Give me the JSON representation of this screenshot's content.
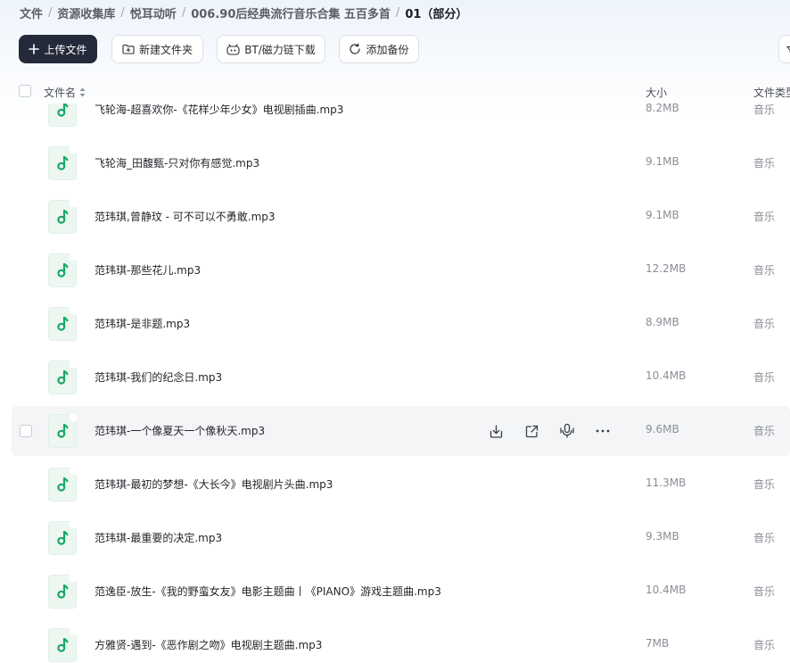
{
  "breadcrumb": {
    "items": [
      "文件",
      "资源收集库",
      "悦耳动听",
      "006.90后经典流行音乐合集 五百多首"
    ],
    "current": "01（部分）",
    "separator": "/"
  },
  "toolbar": {
    "upload_label": "上传文件",
    "new_folder_label": "新建文件夹",
    "bt_label": "BT/磁力链下载",
    "backup_label": "添加备份"
  },
  "table": {
    "headers": {
      "name": "文件名",
      "size": "大小",
      "type": "文件类型"
    },
    "rows": [
      {
        "name": "飞轮海-超喜欢你-《花样少年少女》电视剧插曲.mp3",
        "size": "8.2MB",
        "type": "音乐"
      },
      {
        "name": "飞轮海_田馥甄-只对你有感觉.mp3",
        "size": "9.1MB",
        "type": "音乐"
      },
      {
        "name": "范玮琪,曾静玟 - 可不可以不勇敢.mp3",
        "size": "9.1MB",
        "type": "音乐"
      },
      {
        "name": "范玮琪-那些花儿.mp3",
        "size": "12.2MB",
        "type": "音乐"
      },
      {
        "name": "范玮琪-是非题.mp3",
        "size": "8.9MB",
        "type": "音乐"
      },
      {
        "name": "范玮琪-我们的纪念日.mp3",
        "size": "10.4MB",
        "type": "音乐"
      },
      {
        "name": "范玮琪-一个像夏天一个像秋天.mp3",
        "size": "9.6MB",
        "type": "音乐",
        "hovered": true
      },
      {
        "name": "范玮琪-最初的梦想-《大长今》电视剧片头曲.mp3",
        "size": "11.3MB",
        "type": "音乐"
      },
      {
        "name": "范玮琪-最重要的决定.mp3",
        "size": "9.3MB",
        "type": "音乐"
      },
      {
        "name": "范逸臣-放生-《我的野蛮女友》电影主题曲丨《PIANO》游戏主题曲.mp3",
        "size": "10.4MB",
        "type": "音乐"
      },
      {
        "name": "方雅贤-遇到-《恶作剧之吻》电视剧主题曲.mp3",
        "size": "7MB",
        "type": "音乐"
      }
    ]
  },
  "icons": {
    "file": "music-note-icon",
    "row_actions": [
      "download-icon",
      "share-icon",
      "voice-icon",
      "more-icon"
    ]
  },
  "colors": {
    "primary_button": "#252a3a",
    "music_icon": "#1aa865",
    "hover_row": "#f4f5f7"
  }
}
